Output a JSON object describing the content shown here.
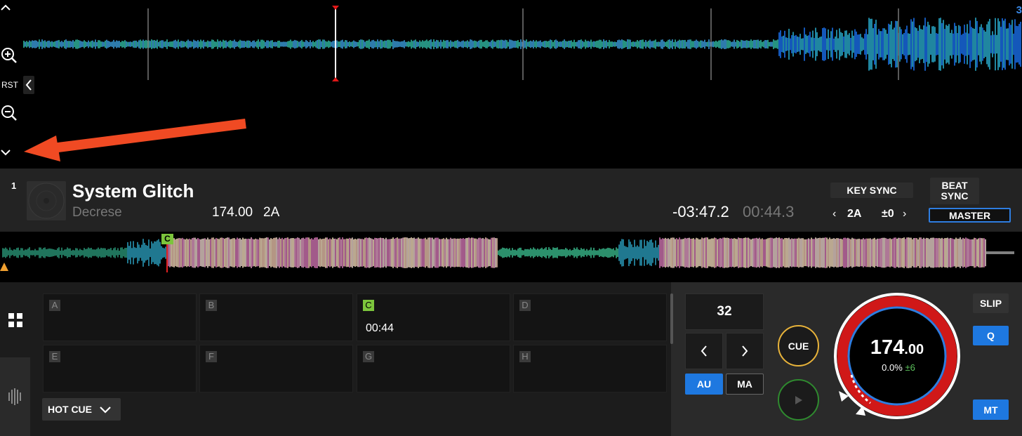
{
  "top_waveform": {
    "rst_label": "RST",
    "deck_corner": "3"
  },
  "deck": {
    "number": "1",
    "title": "System Glitch",
    "artist": "Decrese",
    "bpm": "174.00",
    "key": "2A",
    "remaining_time": "-03:47.2",
    "elapsed_time": "00:44.3",
    "key_sync_label": "KEY SYNC",
    "key_value": "2A",
    "key_shift": "±0",
    "beat_sync_line1": "BEAT",
    "beat_sync_line2": "SYNC",
    "master_label": "MASTER"
  },
  "overview": {
    "cue_marker": "C"
  },
  "pads": {
    "items": [
      {
        "letter": "A",
        "time": "",
        "active": false
      },
      {
        "letter": "B",
        "time": "",
        "active": false
      },
      {
        "letter": "C",
        "time": "00:44",
        "active": true
      },
      {
        "letter": "D",
        "time": "",
        "active": false
      },
      {
        "letter": "E",
        "time": "",
        "active": false
      },
      {
        "letter": "F",
        "time": "",
        "active": false
      },
      {
        "letter": "G",
        "time": "",
        "active": false
      },
      {
        "letter": "H",
        "time": "",
        "active": false
      }
    ],
    "mode_label": "HOT CUE"
  },
  "loop": {
    "size": "32",
    "au_label": "AU",
    "ma_label": "MA"
  },
  "transport": {
    "cue_label": "CUE"
  },
  "jog": {
    "bpm_int": "174",
    "bpm_dec": ".00",
    "pitch": "0.0%",
    "range": "±6"
  },
  "right_buttons": {
    "slip_label": "SLIP",
    "q_label": "Q",
    "mt_label": "MT"
  },
  "colors": {
    "accent_blue": "#1e78e0",
    "cue_green": "#7cc53c",
    "cue_ring": "#e8b33a",
    "play_ring": "#2f8a2f",
    "jog_red": "#d01818",
    "annotation_arrow": "#f04a23"
  }
}
